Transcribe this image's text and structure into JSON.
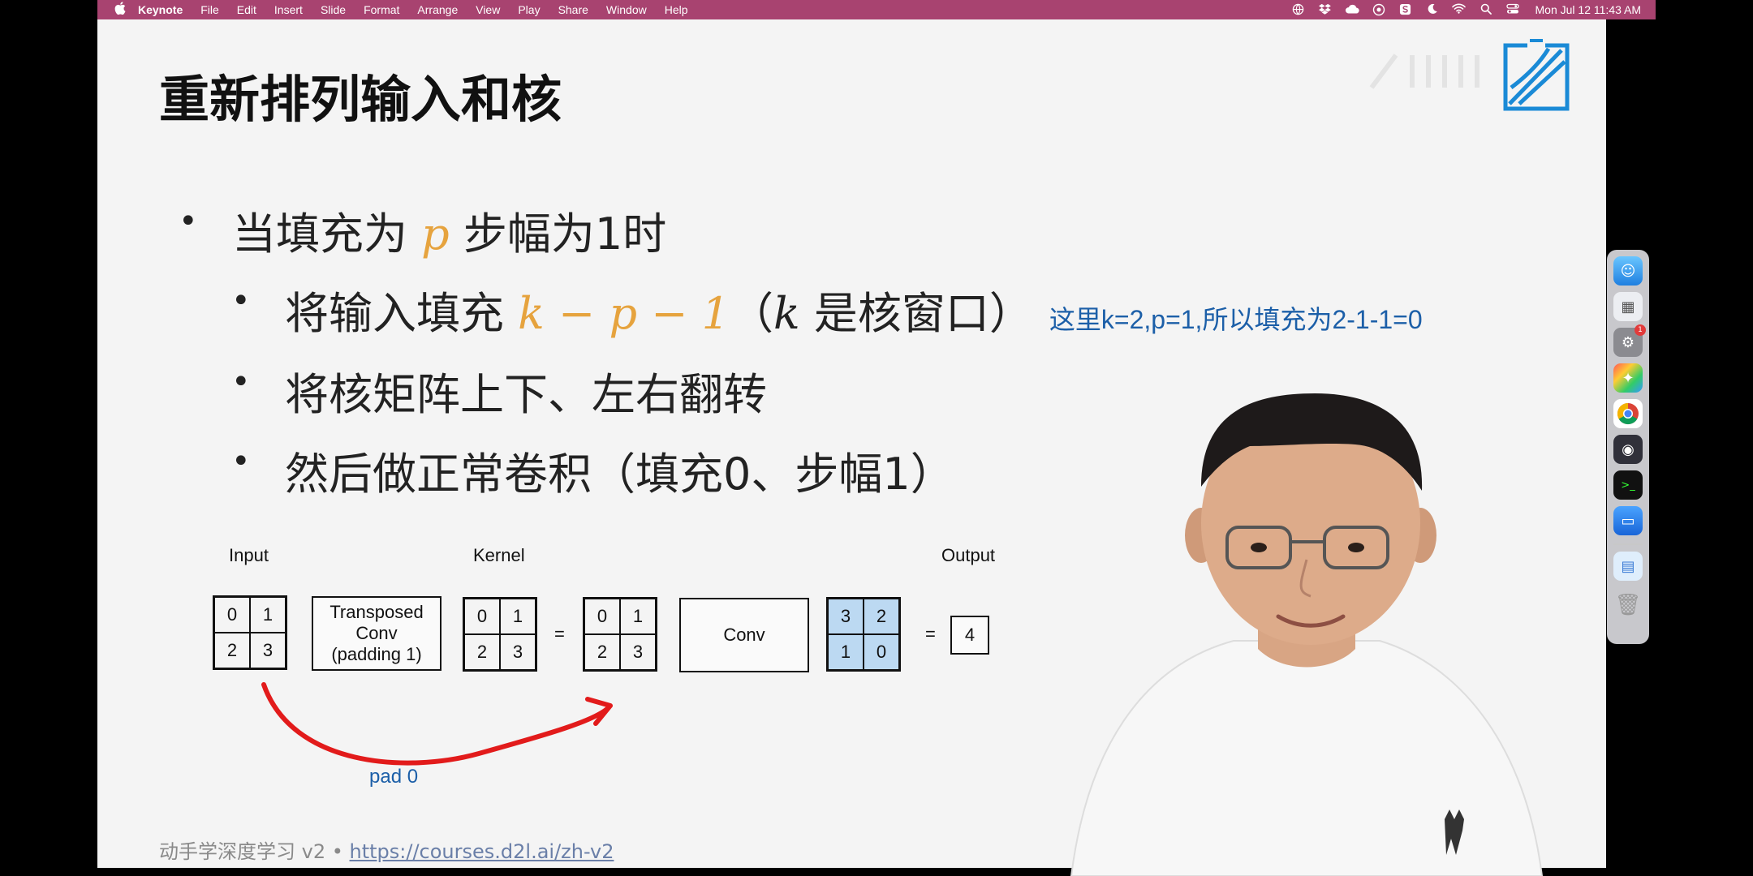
{
  "menubar": {
    "app": "Keynote",
    "items": [
      "File",
      "Edit",
      "Insert",
      "Slide",
      "Format",
      "Arrange",
      "View",
      "Play",
      "Share",
      "Window",
      "Help"
    ],
    "clock": "Mon Jul 12  11:43 AM",
    "status_icons": [
      "globe-icon",
      "dropbox-icon",
      "cloud-icon",
      "camera-icon",
      "s-icon",
      "moon-icon",
      "wifi-icon",
      "search-icon",
      "control-center-icon"
    ]
  },
  "slide": {
    "title": "重新排列输入和核",
    "bullet1": {
      "pre": "当填充为 ",
      "var": "p",
      "post": " 步幅为1时"
    },
    "bullet2": {
      "pre": "将输入填充 ",
      "math": "k − p − 1",
      "open": "（",
      "kvar": "k",
      "post": " 是核窗口）",
      "note": "这里k=2,p=1,所以填充为2-1-1=0"
    },
    "bullet3": "将核矩阵上下、左右翻转",
    "bullet4": "然后做正常卷积（填充0、步幅1）",
    "diagram": {
      "label_input": "Input",
      "label_kernel": "Kernel",
      "label_output": "Output",
      "input": [
        "0",
        "1",
        "2",
        "3"
      ],
      "transposed_conv": [
        "Transposed",
        "Conv",
        "(padding 1)"
      ],
      "kernel": [
        "0",
        "1",
        "2",
        "3"
      ],
      "eq1": "=",
      "padded": [
        "0",
        "1",
        "2",
        "3"
      ],
      "conv": "Conv",
      "flipped_kernel": [
        "3",
        "2",
        "1",
        "0"
      ],
      "eq2": "=",
      "output": "4",
      "pad_label": "pad 0"
    },
    "footer": {
      "prefix": "动手学深度学习 v2 • ",
      "link": "https://courses.d2l.ai/zh-v2"
    }
  },
  "colors": {
    "menubar": "#a84370",
    "accent_orange": "#e6a33e",
    "note_blue": "#1c5fa8",
    "cell_blue": "#bcd9f2",
    "arrow_red": "#e21b1b"
  },
  "dock": [
    "finder-icon",
    "launchpad-icon",
    "system-preferences-icon",
    "final-cut-icon",
    "chrome-icon",
    "obs-icon",
    "terminal-icon",
    "keynote-icon",
    "preview-icon",
    "trash-icon"
  ]
}
